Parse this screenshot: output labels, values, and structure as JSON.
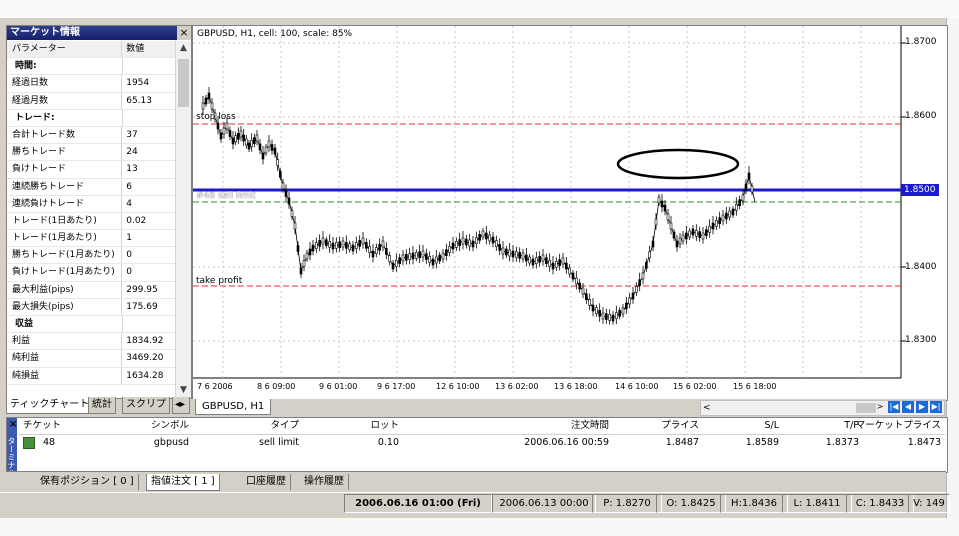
{
  "market_info": {
    "title": "マーケット情報",
    "close": "×",
    "header": {
      "param": "パラメーター",
      "value": "数値"
    },
    "rows": [
      {
        "k": "時間:",
        "v": "",
        "section": true
      },
      {
        "k": "経過日数",
        "v": "1954"
      },
      {
        "k": "経過月数",
        "v": "65.13"
      },
      {
        "k": "トレード:",
        "v": "",
        "section": true
      },
      {
        "k": "合計トレード数",
        "v": "37"
      },
      {
        "k": "勝ちトレード",
        "v": "24"
      },
      {
        "k": "負けトレード",
        "v": "13"
      },
      {
        "k": "連続勝ちトレード",
        "v": "6"
      },
      {
        "k": "連続負けトレード",
        "v": "4"
      },
      {
        "k": "トレード(1日あたり)",
        "v": "0.02"
      },
      {
        "k": "トレード(1月あたり)",
        "v": "1"
      },
      {
        "k": "勝ちトレード(1月あたり)",
        "v": "0"
      },
      {
        "k": "負けトレード(1月あたり)",
        "v": "0"
      },
      {
        "k": "最大利益(pips)",
        "v": "299.95"
      },
      {
        "k": "最大損失(pips)",
        "v": "175.69"
      },
      {
        "k": "収益",
        "v": "",
        "section": true
      },
      {
        "k": "利益",
        "v": "1834.92"
      },
      {
        "k": "純利益",
        "v": "3469.20"
      },
      {
        "k": "純損益",
        "v": "1634.28"
      }
    ],
    "tabs": [
      "ティックチャート",
      "統計",
      "スクリプ"
    ]
  },
  "chart": {
    "title": "GBPUSD, H1, cell: 100, scale: 85%",
    "tab": "GBPUSD, H1",
    "y_labels": [
      "1.8700",
      "1.8600",
      "1.8500",
      "1.8400",
      "1.8300"
    ],
    "x_labels": [
      "7 6 2006",
      "8 6 09:00",
      "9 6 01:00",
      "9 6 17:00",
      "12 6 10:00",
      "13 6 02:00",
      "13 6 18:00",
      "14 6 10:00",
      "15 6 02:00",
      "15 6 18:00"
    ],
    "levels": {
      "stop": "stop loss",
      "sell": "#48 sell limit",
      "tp": "take profit"
    },
    "colors": {
      "sell_line": "#1a1acc",
      "stop_line": "#e03030",
      "tp_line": "#e03030",
      "entry_line": "#2e8b2e"
    },
    "scroll_left": "<",
    "scroll_right": ">"
  },
  "terminal": {
    "side_label": "ターミナル",
    "close": "×",
    "headers": [
      "チケット",
      "シンボル",
      "タイプ",
      "ロット",
      "注文時間",
      "プライス",
      "S/L",
      "T/P",
      "マーケットプライス"
    ],
    "row": [
      "48",
      "gbpusd",
      "sell limit",
      "0.10",
      "2006.06.16 00:59",
      "1.8487",
      "1.8589",
      "1.8373",
      "1.8473"
    ],
    "tabs": [
      "保有ポジション [ 0 ]",
      "指値注文 [ 1 ]",
      "口座履歴",
      "操作履歴"
    ]
  },
  "status": [
    "2006.06.16 01:00 (Fri)",
    "2006.06.13 00:00",
    "P: 1.8270",
    "O: 1.8425",
    "H:1.8436",
    "L: 1.8411",
    "C: 1.8433",
    "V: 149"
  ]
}
